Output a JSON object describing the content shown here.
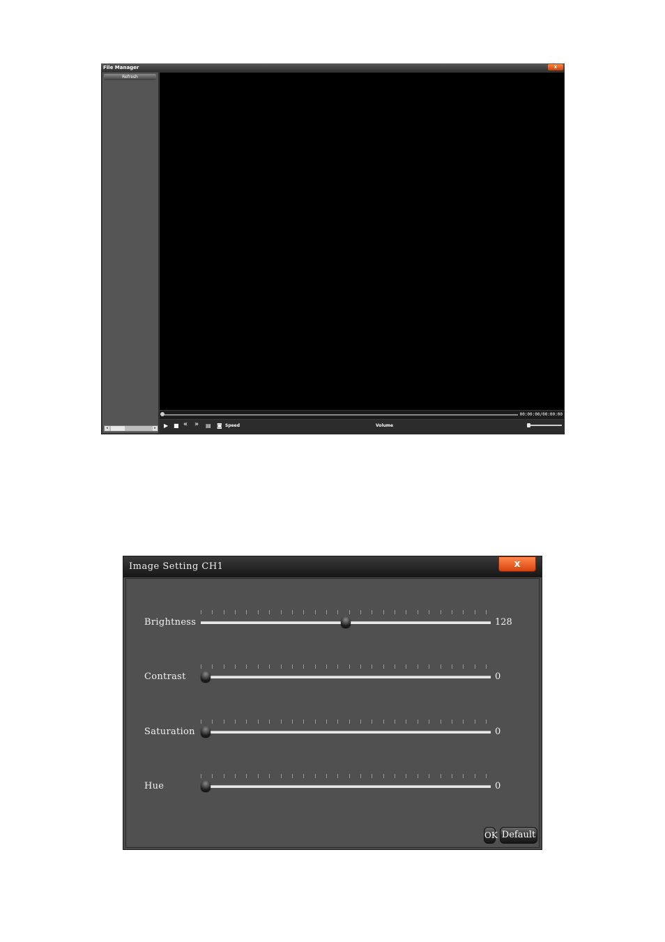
{
  "file_manager": {
    "title": "File Manager",
    "close_glyph": "x",
    "refresh_label": "Refresh",
    "time_display": "00:00:00/00:00:00",
    "seek_position": 0,
    "controls": {
      "play_icon": "▶",
      "stop_icon": "■",
      "rewind_icon": "«",
      "forward_icon": "»",
      "step_icon": "▤",
      "snapshot_icon": "◙"
    },
    "speed_label": "Speed",
    "volume_label": "Volume",
    "volume_level": 0
  },
  "image_setting": {
    "title": "Image Setting  CH1",
    "close_glyph": "x",
    "sliders": [
      {
        "label": "Brightness",
        "value": "128",
        "level": 0.5
      },
      {
        "label": "Contrast",
        "value": "0",
        "level": 0
      },
      {
        "label": "Saturation",
        "value": "0",
        "level": 0
      },
      {
        "label": "Hue",
        "value": "0",
        "level": 0
      }
    ],
    "ok_label": "OK",
    "default_label": "Default"
  }
}
